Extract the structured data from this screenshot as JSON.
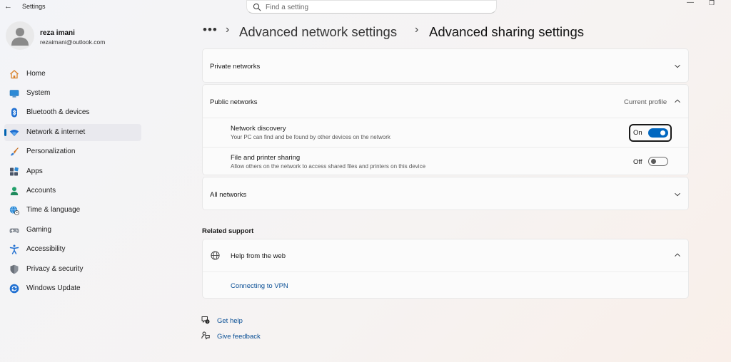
{
  "window": {
    "title": "Settings",
    "back_glyph": "←",
    "minimize_glyph": "—",
    "maximize_glyph": "❐"
  },
  "search": {
    "placeholder": "Find a setting",
    "value": ""
  },
  "user": {
    "name": "reza imani",
    "email": "rezaimani@outlook.com"
  },
  "nav": {
    "active": "Network & internet",
    "items": [
      {
        "label": "Home",
        "icon": "home-icon"
      },
      {
        "label": "System",
        "icon": "system-icon"
      },
      {
        "label": "Bluetooth & devices",
        "icon": "bluetooth-icon"
      },
      {
        "label": "Network & internet",
        "icon": "wifi-icon"
      },
      {
        "label": "Personalization",
        "icon": "brush-icon"
      },
      {
        "label": "Apps",
        "icon": "apps-icon"
      },
      {
        "label": "Accounts",
        "icon": "accounts-icon"
      },
      {
        "label": "Time & language",
        "icon": "globe-clock-icon"
      },
      {
        "label": "Gaming",
        "icon": "gamepad-icon"
      },
      {
        "label": "Accessibility",
        "icon": "accessibility-icon"
      },
      {
        "label": "Privacy & security",
        "icon": "shield-icon"
      },
      {
        "label": "Windows Update",
        "icon": "update-icon"
      }
    ]
  },
  "breadcrumb": {
    "more": "•••",
    "separator": "›",
    "parent": "Advanced network settings",
    "current": "Advanced sharing settings"
  },
  "sections": {
    "private": {
      "title": "Private networks",
      "expanded": false
    },
    "public": {
      "title": "Public networks",
      "badge": "Current profile",
      "expanded": true,
      "rows": [
        {
          "title": "Network discovery",
          "subtitle": "Your PC can find and be found by other devices on the network",
          "state": "On",
          "on": true
        },
        {
          "title": "File and printer sharing",
          "subtitle": "Allow others on the network to access shared files and printers on this device",
          "state": "Off",
          "on": false
        }
      ]
    },
    "all": {
      "title": "All networks",
      "expanded": false
    }
  },
  "related_support": {
    "heading": "Related support",
    "help_title": "Help from the web",
    "expanded": true,
    "links": [
      "Connecting to VPN"
    ]
  },
  "footer": {
    "get_help": "Get help",
    "give_feedback": "Give feedback"
  },
  "colors": {
    "accent": "#0067c0",
    "link": "#0a4f95",
    "nav_active_bg": "#e9e9ee"
  }
}
